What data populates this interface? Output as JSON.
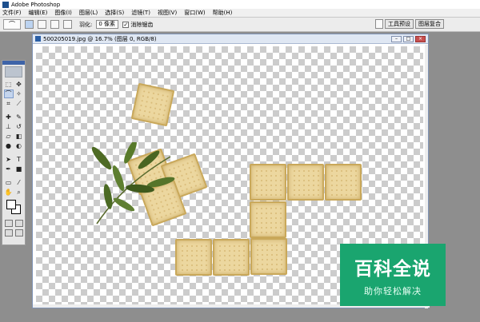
{
  "app": {
    "title": "Adobe Photoshop"
  },
  "menu": [
    "文件(F)",
    "编辑(E)",
    "图像(I)",
    "图层(L)",
    "选择(S)",
    "滤镜(T)",
    "视图(V)",
    "窗口(W)",
    "帮助(H)"
  ],
  "options_bar": {
    "feather_label": "羽化:",
    "feather_value": "0 像素",
    "antialias_label": "消除锯齿",
    "antialias_checked": true,
    "well_tabs": [
      "工具预设",
      "图层复合"
    ]
  },
  "document": {
    "title": "500205019.jpg @ 16.7% (图层 0, RGB/8)"
  },
  "toolbar": {
    "tool_icons": [
      "rectangular-marquee-icon",
      "move-icon",
      "lasso-icon",
      "magic-wand-icon",
      "crop-icon",
      "slice-icon",
      "healing-brush-icon",
      "brush-icon",
      "clone-stamp-icon",
      "history-brush-icon",
      "eraser-icon",
      "gradient-icon",
      "blur-icon",
      "dodge-icon",
      "path-selection-icon",
      "type-icon",
      "pen-icon",
      "rectangle-shape-icon",
      "notes-icon",
      "eyedropper-icon",
      "hand-icon",
      "zoom-icon"
    ],
    "foreground_color": "#ffffff",
    "background_color": "#ffffff"
  },
  "watermark": {
    "title": "百科全说",
    "subtitle": "助你轻松解决",
    "color": "#1aa56f"
  },
  "colors": {
    "window_border": "#7f93b6",
    "accent": "#3e64a8"
  }
}
